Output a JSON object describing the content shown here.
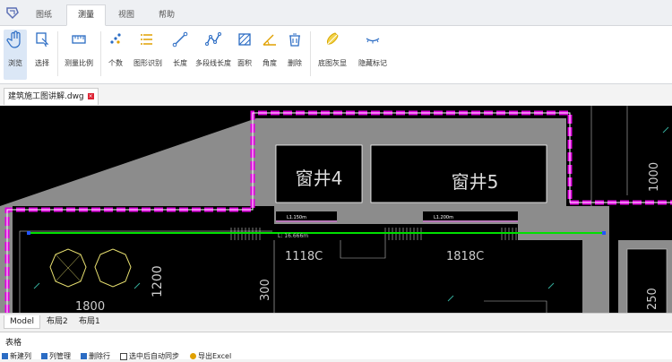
{
  "tabs": [
    {
      "label": "图纸",
      "active": false
    },
    {
      "label": "测量",
      "active": true
    },
    {
      "label": "视图",
      "active": false
    },
    {
      "label": "帮助",
      "active": false
    }
  ],
  "ribbon": {
    "browse": "浏览",
    "select": "选择",
    "scale": "测量比例",
    "count": "个数",
    "shape_recognize": "图形识别",
    "length": "长度",
    "polyline_length": "多段线长度",
    "area": "面积",
    "angle": "角度",
    "delete": "删除",
    "gray_background": "底图灰显",
    "hide_marks": "隐藏标记"
  },
  "document": {
    "tab_name": "建筑施工图讲解.dwg",
    "close_glyph": "×"
  },
  "drawing": {
    "room1": "窗井4",
    "room2": "窗井5",
    "dim1": "1118C",
    "dim2": "1818C",
    "dim_1200": "1200",
    "dim_300": "300",
    "dim_1800": "1800",
    "dim_250": "250",
    "dim_1000": "1000",
    "small_label1": "L1.150m",
    "small_label2": "L1.200m",
    "measure_label": "L: 16.666m"
  },
  "layouts": [
    {
      "label": "Model",
      "active": true
    },
    {
      "label": "布局2",
      "active": false
    },
    {
      "label": "布局1",
      "active": false
    }
  ],
  "panel": {
    "title": "表格",
    "tools": [
      "新建列",
      "列管理",
      "删除行",
      "选中后自动同步",
      "导出Excel"
    ]
  },
  "colors": {
    "wall": "#8c8c8c",
    "boundary": "#e000e0",
    "measure": "#00e000",
    "selected_bg": "#dbe7f6"
  }
}
